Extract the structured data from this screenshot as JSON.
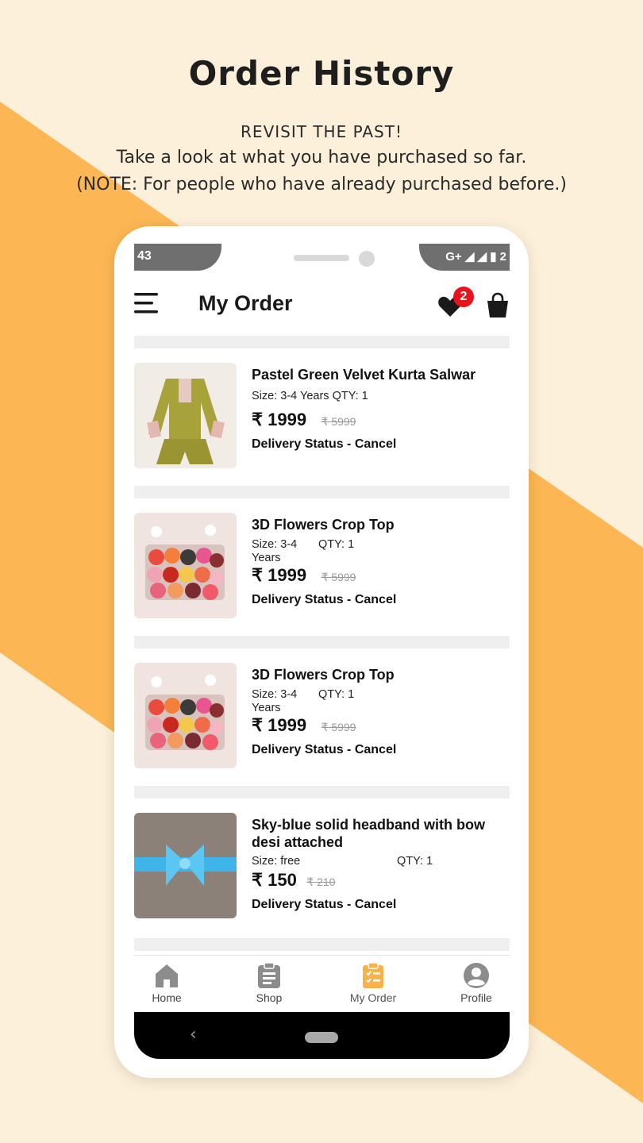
{
  "colors": {
    "accent": "#f9b24a",
    "background": "#fdf0da",
    "badge": "#e8141c",
    "active_nav": "#f9b24a"
  },
  "promo": {
    "title": "Order History",
    "line1": "REVISIT THE PAST!",
    "line2": "Take a look at what you have purchased so far.",
    "line3": "(NOTE: For people who have already purchased before.)"
  },
  "statusbar": {
    "time": "43",
    "network": "G+ ◢ ◢ ▮ 2"
  },
  "appbar": {
    "title": "My Order",
    "wishlist_count": "2",
    "menu_icon": "menu-icon",
    "wishlist_icon": "heart-icon",
    "cart_icon": "bag-icon"
  },
  "orders": [
    {
      "name": "Pastel Green Velvet Kurta Salwar",
      "size": "Size: 3-4 Years",
      "qty": "QTY: 1",
      "price": "₹ 1999",
      "mrp": "₹ 5999",
      "status": "Delivery Status - Cancel"
    },
    {
      "name": "3D Flowers Crop Top",
      "size": "Size: 3-4 Years",
      "qty": "QTY: 1",
      "price": "₹ 1999",
      "mrp": "₹ 5999",
      "status": "Delivery Status - Cancel"
    },
    {
      "name": "3D Flowers Crop Top",
      "size": "Size: 3-4 Years",
      "qty": "QTY: 1",
      "price": "₹ 1999",
      "mrp": "₹ 5999",
      "status": "Delivery Status - Cancel"
    },
    {
      "name": "Sky-blue solid headband with bow desi attached",
      "size": "Size: free",
      "qty": "QTY: 1",
      "price": "₹ 150",
      "mrp": "₹ 210",
      "status": "Delivery Status - Cancel"
    }
  ],
  "navbar": {
    "items": [
      {
        "label": "Home",
        "icon": "home-icon"
      },
      {
        "label": "Shop",
        "icon": "clipboard-icon"
      },
      {
        "label": "My Order",
        "icon": "order-checklist-icon",
        "active": true
      },
      {
        "label": "Profile",
        "icon": "profile-icon"
      }
    ]
  }
}
